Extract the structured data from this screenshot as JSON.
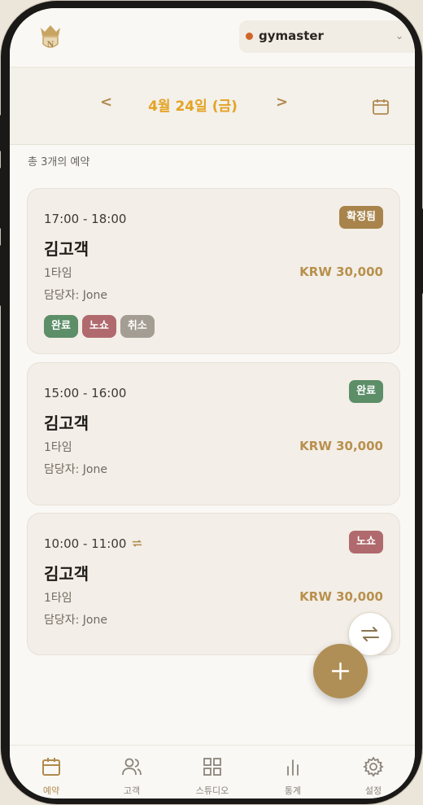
{
  "topbar": {
    "logo_icon": "crown-n-logo",
    "workspace_name": "gymaster",
    "status_color": "#d0652a"
  },
  "datebar": {
    "prev_label": "<",
    "next_label": ">",
    "date_label": "4월 24일 (금)"
  },
  "summary": {
    "count_text": "총 3개의 예약"
  },
  "bookings": [
    {
      "time": "17:00 - 18:00",
      "customer": "김고객",
      "session": "1타임",
      "staff": "담당자: Jone",
      "price": "KRW 30,000",
      "status": "확정됨",
      "actions": {
        "done": "완료",
        "noshow": "노쇼",
        "cancel": "취소"
      }
    },
    {
      "time": "15:00 - 16:00",
      "customer": "김고객",
      "session": "1타임",
      "staff": "담당자: Jone",
      "price": "KRW 30,000",
      "status": "완료"
    },
    {
      "time": "10:00 - 11:00",
      "customer": "김고객",
      "session": "1타임",
      "staff": "담당자: Jone",
      "price": "KRW 30,000",
      "status": "노쇼",
      "recurring_icon": "repeat-icon"
    }
  ],
  "colors": {
    "accent": "#b08a4e",
    "date": "#e3a323",
    "confirmed": "#a8844c",
    "done": "#5c8e68",
    "noshow": "#b06a6e",
    "cancel": "#a39d93"
  },
  "bottom_nav": [
    {
      "label": "예약",
      "icon": "calendar-icon",
      "active": true
    },
    {
      "label": "고객",
      "icon": "users-icon"
    },
    {
      "label": "스튜디오",
      "icon": "grid-icon"
    },
    {
      "label": "통계",
      "icon": "bar-chart-icon"
    },
    {
      "label": "설정",
      "icon": "gear-icon"
    }
  ]
}
